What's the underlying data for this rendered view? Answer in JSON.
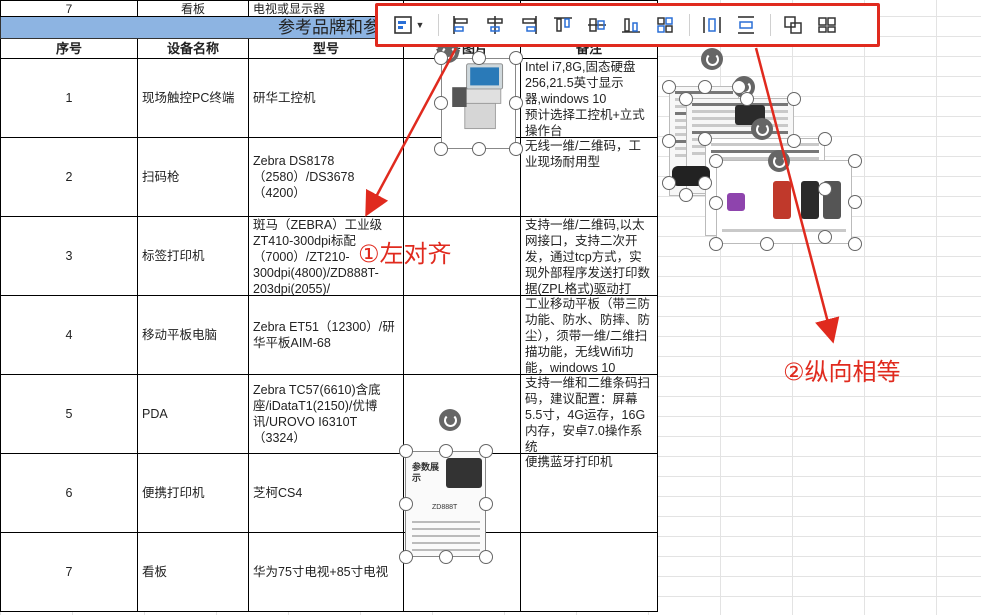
{
  "sheet": {
    "top_row": {
      "idx": "7",
      "name": "看板",
      "model": "电视或显示器"
    },
    "banner": "参考品牌和参",
    "headers": {
      "idx": "序号",
      "name": "设备名称",
      "model": "型号",
      "image": "参考图片",
      "note": "备注"
    },
    "rows": [
      {
        "idx": "1",
        "name": "现场触控PC终端",
        "model": "研华工控机",
        "note": "Intel i7,8G,固态硬盘256,21.5英寸显示器,windows 10\n预计选择工控机+立式操作台"
      },
      {
        "idx": "2",
        "name": "扫码枪",
        "model": "Zebra DS8178（2580）/DS3678（4200）",
        "note": "无线一维/二维码，工业现场耐用型"
      },
      {
        "idx": "3",
        "name": "标签打印机",
        "model": "斑马（ZEBRA）工业级ZT410-300dpi标配（7000）/ZT210-300dpi(4800)/ZD888T-203dpi(2055)/",
        "note": "支持一维/二维码,以太网接口，支持二次开发，通过tcp方式，实现外部程序发送打印数据(ZPL格式)驱动打"
      },
      {
        "idx": "4",
        "name": "移动平板电脑",
        "model": "Zebra ET51（12300）/研华平板AIM-68",
        "note": "工业移动平板（带三防功能、防水、防摔、防尘），须带一维/二维扫描功能，无线Wifi功能，windows 10"
      },
      {
        "idx": "5",
        "name": "PDA",
        "model": "Zebra TC57(6610)含底座/iDataT1(2150)/优博讯/UROVO I6310T（3324）",
        "note": "支持一维和二维条码扫码，建议配置：屏幕5.5寸，4G运存，16G内存，安卓7.0操作系统"
      },
      {
        "idx": "6",
        "name": "便携打印机",
        "model": "芝柯CS4",
        "note": "便携蓝牙打印机"
      },
      {
        "idx": "7",
        "name": "看板",
        "model": "华为75寸电视+85寸电视",
        "note": ""
      }
    ]
  },
  "toolbar": {
    "buttons": [
      {
        "name": "align-dropdown-icon"
      },
      {
        "name": "align-left-icon"
      },
      {
        "name": "align-center-horizontal-icon"
      },
      {
        "name": "align-right-icon"
      },
      {
        "name": "align-top-icon"
      },
      {
        "name": "align-middle-vertical-icon"
      },
      {
        "name": "align-bottom-icon"
      },
      {
        "name": "distribute-grid-icon"
      },
      {
        "name": "distribute-horizontal-icon"
      },
      {
        "name": "distribute-vertical-icon"
      },
      {
        "name": "group-icon"
      },
      {
        "name": "ungroup-icon"
      }
    ]
  },
  "printer_doc": {
    "heading": "参数展示",
    "model": "ZD888T"
  },
  "annotations": {
    "a1": "①左对齐",
    "a2": "②纵向相等"
  },
  "colors": {
    "accent": "#e02a1e",
    "banner": "#8db4e2"
  }
}
